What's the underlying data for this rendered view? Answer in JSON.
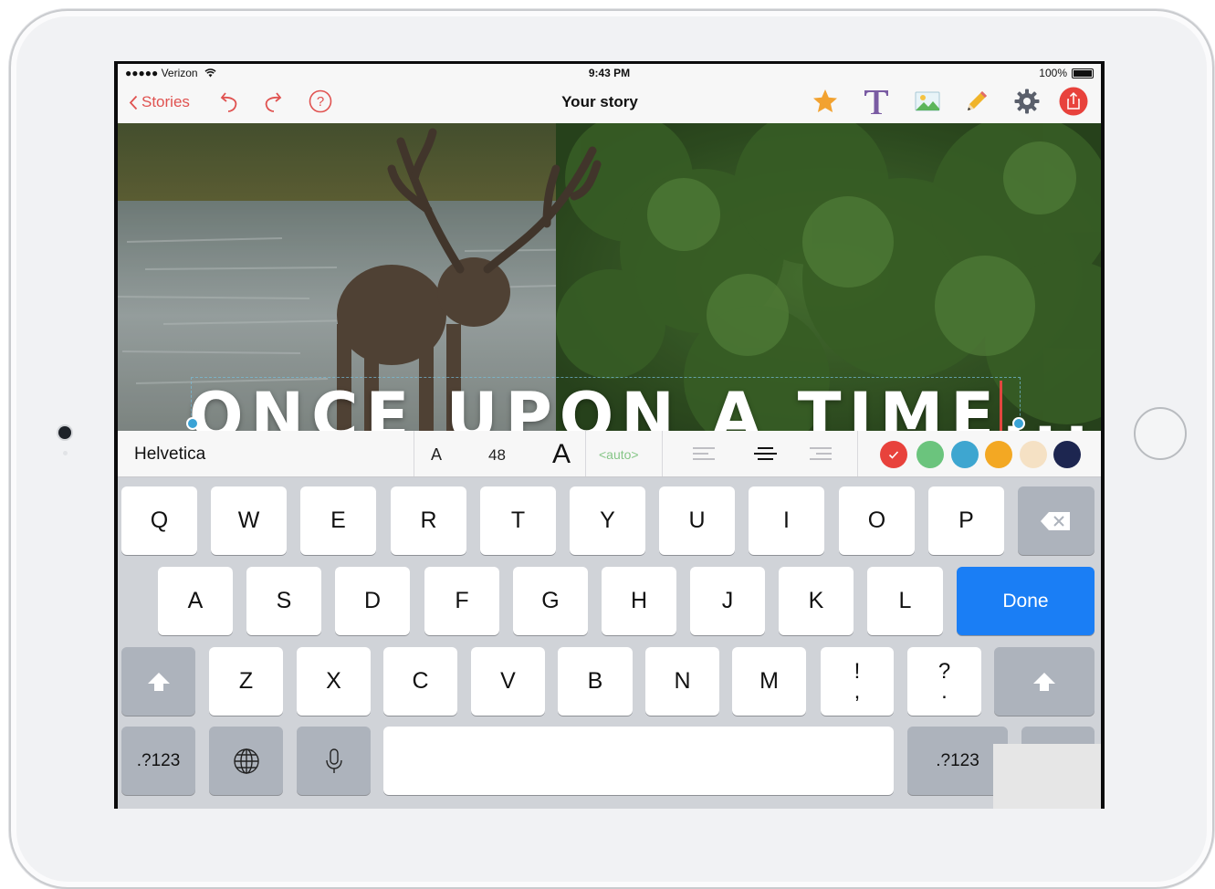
{
  "status_bar": {
    "carrier": "●●●●● Verizon",
    "time": "9:43 PM",
    "battery": "100%"
  },
  "nav": {
    "back_label": "Stories",
    "title": "Your story"
  },
  "nav_icons": [
    "undo-icon",
    "redo-icon",
    "help-icon",
    "star-icon",
    "text-icon",
    "image-icon",
    "pencil-icon",
    "gear-icon",
    "share-icon"
  ],
  "canvas": {
    "text": "ONCE UPON A TIME..."
  },
  "format_bar": {
    "font_name": "Helvetica",
    "small_a": "A",
    "font_size": "48",
    "big_a": "A",
    "line_height": "<auto>",
    "alignments": [
      "align-left",
      "align-center",
      "align-right"
    ],
    "swatches": [
      "#e8423c",
      "#6bc47d",
      "#3ea6d0",
      "#f3a823",
      "#f5e1c4",
      "#1d2650"
    ],
    "selected_swatch": "#e8423c"
  },
  "keyboard": {
    "row1": [
      "Q",
      "W",
      "E",
      "R",
      "T",
      "Y",
      "U",
      "I",
      "O",
      "P"
    ],
    "row2": [
      "A",
      "S",
      "D",
      "F",
      "G",
      "H",
      "J",
      "K",
      "L"
    ],
    "done_label": "Done",
    "row3": [
      "Z",
      "X",
      "C",
      "V",
      "B",
      "N",
      "M"
    ],
    "punct1": {
      "top": "!",
      "bottom": ","
    },
    "punct2": {
      "top": "?",
      "bottom": "."
    },
    "numbers_label": ".?123"
  },
  "colors": {
    "accent": "#e05250",
    "done": "#1a7ef5",
    "caret": "#e2463f"
  }
}
